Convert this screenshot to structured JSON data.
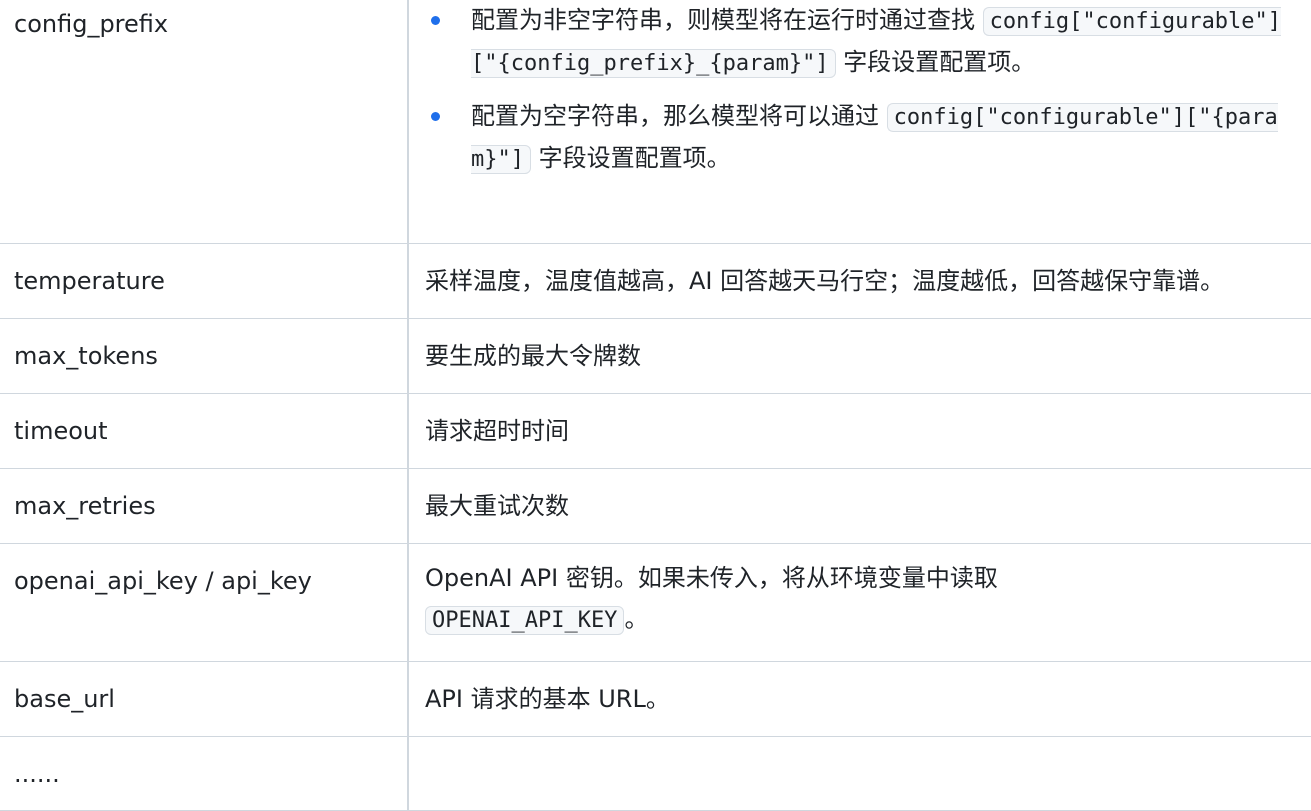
{
  "rows": [
    {
      "name": "config_prefix",
      "bullets": [
        {
          "text_before": "配置为非空字符串，则模型将在运行时通过查找",
          "code": "config[\"configurable\"][\"{config_prefix}_{param}\"]",
          "text_after": "字段设置配置项。"
        },
        {
          "text_before": "配置为空字符串，那么模型将可以通过",
          "code": "config[\"configurable\"][\"{param}\"]",
          "text_after": "字段设置配置项。"
        }
      ]
    },
    {
      "name": "temperature",
      "description": "采样温度，温度值越高，AI 回答越天马行空；温度越低，回答越保守靠谱。"
    },
    {
      "name": "max_tokens",
      "description": "要生成的最大令牌数"
    },
    {
      "name": "timeout",
      "description": "请求超时时间"
    },
    {
      "name": "max_retries",
      "description": "最大重试次数"
    },
    {
      "name": "openai_api_key / api_key",
      "description_before": "OpenAI API 密钥。如果未传入，将从环境变量中读取",
      "code": "OPENAI_API_KEY",
      "description_after": "。"
    },
    {
      "name": "base_url",
      "description": "API 请求的基本 URL。"
    },
    {
      "name": "......",
      "description": ""
    }
  ],
  "colors": {
    "border": "#d0d7de",
    "bullet": "#1f6feb",
    "code_bg": "#f6f8fa",
    "text": "#1f2328"
  }
}
